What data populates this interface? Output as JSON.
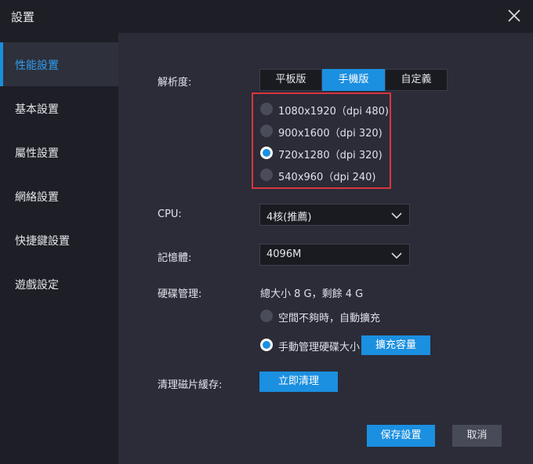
{
  "window": {
    "title": "設置"
  },
  "sidebar": {
    "items": [
      {
        "label": "性能設置",
        "active": true
      },
      {
        "label": "基本設置",
        "active": false
      },
      {
        "label": "屬性設置",
        "active": false
      },
      {
        "label": "網絡設置",
        "active": false
      },
      {
        "label": "快捷鍵設置",
        "active": false
      },
      {
        "label": "遊戲設定",
        "active": false
      }
    ]
  },
  "resolution": {
    "label": "解析度:",
    "tabs": [
      "平板版",
      "手機版",
      "自定義"
    ],
    "active_tab": "手機版",
    "options": [
      {
        "text": "1080x1920（dpi 480)",
        "selected": false
      },
      {
        "text": "900x1600（dpi 320)",
        "selected": false
      },
      {
        "text": "720x1280（dpi 320)",
        "selected": true
      },
      {
        "text": "540x960（dpi 240)",
        "selected": false
      }
    ]
  },
  "cpu": {
    "label": "CPU:",
    "value": "4核(推薦)"
  },
  "memory": {
    "label": "記憶體:",
    "value": "4096M"
  },
  "disk": {
    "label": "硬碟管理:",
    "summary": "總大小 8 G，剩餘 4 G",
    "options": [
      {
        "text": "空間不夠時，自動擴充",
        "selected": false
      },
      {
        "text": "手動管理硬碟大小",
        "selected": true
      }
    ],
    "expand_button": "擴充容量"
  },
  "cache": {
    "label": "清理磁片緩存:",
    "button": "立即清理"
  },
  "footer": {
    "save": "保存設置",
    "cancel": "取消"
  },
  "colors": {
    "accent": "#1b8fe0",
    "highlight_box": "#d9363e",
    "sidebar_active_text": "#2f9ef0"
  },
  "icons": {
    "close": "close-icon",
    "dropdown": "chevron-down-icon"
  }
}
